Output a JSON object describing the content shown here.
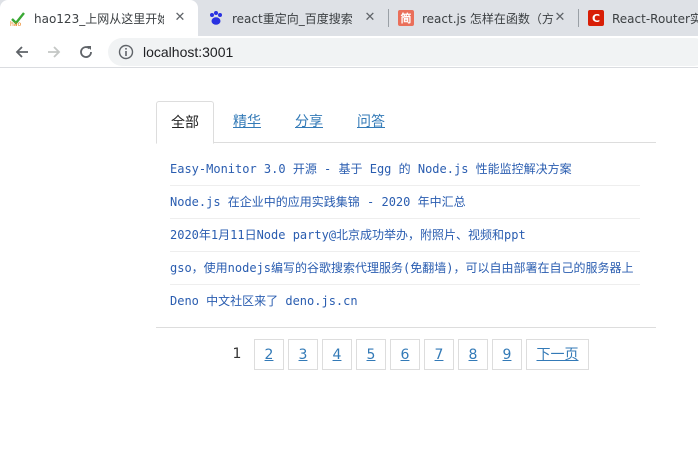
{
  "browser": {
    "tabs": [
      {
        "title": "hao123_上网从这里开始",
        "icon": "hao123-icon"
      },
      {
        "title": "react重定向_百度搜索",
        "icon": "baidu-paw-icon"
      },
      {
        "title": "react.js 怎样在函数（方",
        "icon": "jianshu-icon"
      },
      {
        "title": "React-Router实",
        "icon": "csdn-icon"
      }
    ],
    "close_glyph": "✕",
    "url": "localhost:3001"
  },
  "page": {
    "tabs": [
      {
        "label": "全部"
      },
      {
        "label": "精华"
      },
      {
        "label": "分享"
      },
      {
        "label": "问答"
      }
    ],
    "topics": [
      "Easy-Monitor 3.0 开源 - 基于 Egg 的 Node.js 性能监控解决方案",
      "Node.js 在企业中的应用实践集锦 - 2020 年中汇总",
      "2020年1月11日Node party@北京成功举办，附照片、视频和ppt",
      "gso，使用nodejs编写的谷歌搜索代理服务(免翻墙)，可以自由部署在自己的服务器上",
      "Deno 中文社区来了 deno.js.cn"
    ],
    "pagination": {
      "current": "1",
      "pages": [
        "2",
        "3",
        "4",
        "5",
        "6",
        "7",
        "8",
        "9"
      ],
      "next_label": "下一页"
    }
  },
  "colors": {
    "link": "#337ab7",
    "topic_link": "#2a5db0",
    "chrome_tabstrip": "#dee1e6",
    "omnibox": "#f1f3f4"
  }
}
